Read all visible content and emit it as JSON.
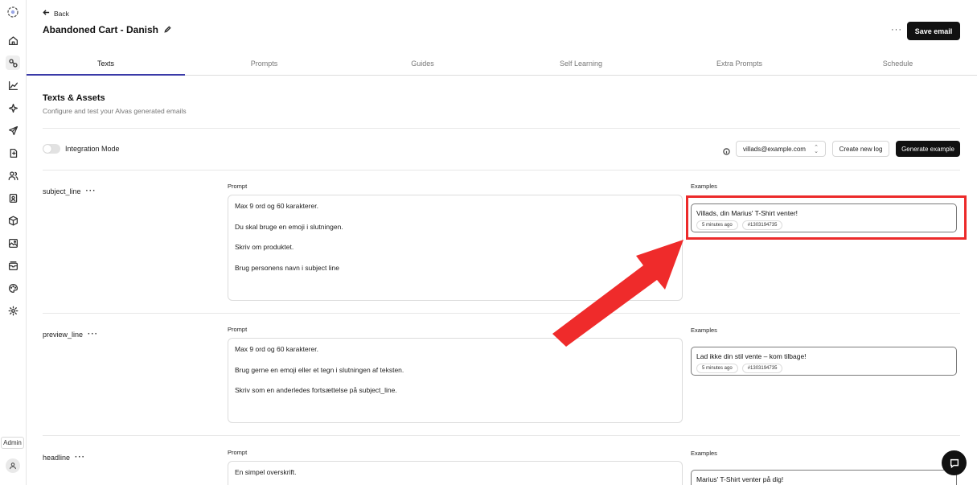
{
  "nav": {
    "back_label": "Back",
    "admin_label": "Admin",
    "rail_icons": [
      "logo-icon",
      "home-icon",
      "connections-icon",
      "chart-icon",
      "sparkle-icon",
      "send-icon",
      "flow-icon",
      "users-icon",
      "contact-card-icon",
      "package-icon",
      "gallery-icon",
      "mail-stack-icon",
      "palette-icon",
      "settings-icon"
    ]
  },
  "header": {
    "title": "Abandoned Cart - Danish",
    "more_label": "···",
    "save_label": "Save email"
  },
  "tabs": [
    "Texts",
    "Prompts",
    "Guides",
    "Self Learning",
    "Extra Prompts",
    "Schedule"
  ],
  "active_tab": "Texts",
  "section": {
    "title": "Texts & Assets",
    "subtitle": "Configure and test your Alvas generated emails"
  },
  "toolbar": {
    "integration_label": "Integration Mode",
    "integration_on": false,
    "email_select": "villads@example.com",
    "create_log_label": "Create new log",
    "generate_label": "Generate example"
  },
  "fields": [
    {
      "name": "subject_line",
      "more": "···",
      "prompt_label": "Prompt",
      "examples_label": "Examples",
      "prompt_lines": [
        "Max 9 ord og 60 karakterer.",
        "Du skal bruge en emoji i slutningen.",
        "Skriv om produktet.",
        "Brug personens navn i subject line"
      ],
      "example": {
        "text": "Villads, din Marius' T-Shirt venter!",
        "time": "5 minutes ago",
        "id": "#1303194735"
      }
    },
    {
      "name": "preview_line",
      "more": "···",
      "prompt_label": "Prompt",
      "examples_label": "Examples",
      "prompt_lines": [
        "Max 9 ord og 60 karakterer.",
        "Brug gerne en emoji eller et tegn i slutningen af teksten.",
        "Skriv som en anderledes fortsættelse på subject_line."
      ],
      "example": {
        "text": "Lad ikke din stil vente – kom tilbage!",
        "time": "5 minutes ago",
        "id": "#1303194735"
      }
    },
    {
      "name": "headline",
      "more": "···",
      "prompt_label": "Prompt",
      "examples_label": "Examples",
      "prompt_lines": [
        "En simpel overskrift."
      ],
      "example": {
        "text": "Marius' T-Shirt venter på dig!"
      }
    }
  ],
  "colors": {
    "accent_tab": "#3a3aa8",
    "highlight": "#ec2a2a",
    "arrow": "#ef2b2b",
    "dark_button": "#111111"
  }
}
